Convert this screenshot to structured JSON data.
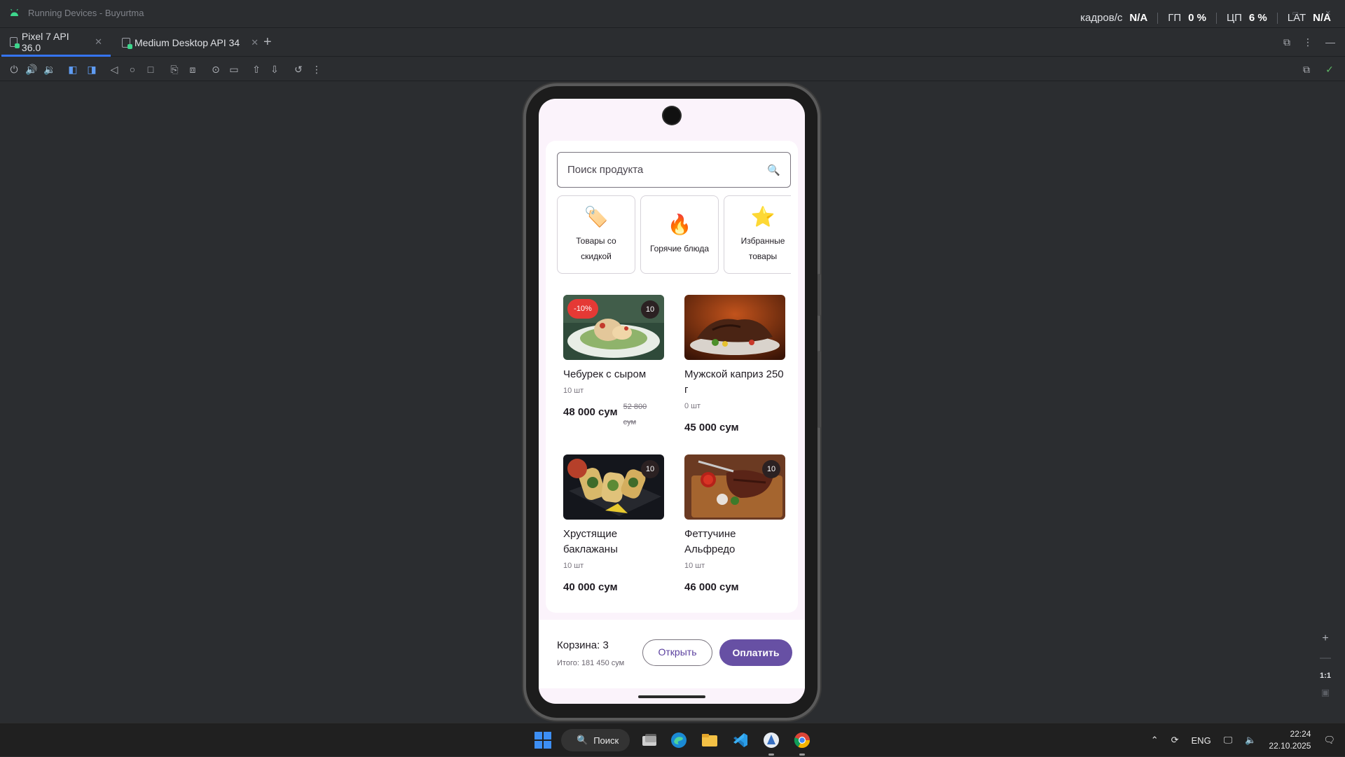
{
  "window": {
    "title": "Running Devices - Buyurtma"
  },
  "stats": [
    {
      "label": "кадров/с",
      "value": "N/A"
    },
    {
      "label": "ГП",
      "value": "0 %"
    },
    {
      "label": "ЦП",
      "value": "6 %"
    },
    {
      "label": "LAT",
      "value": "N/A"
    }
  ],
  "tabs": [
    {
      "label": "Pixel 7 API 36.0",
      "active": true
    },
    {
      "label": "Medium Desktop API 34",
      "active": false
    }
  ],
  "app": {
    "search": {
      "placeholder": "Поиск продукта"
    },
    "categories": [
      {
        "icon": "price-tag-icon",
        "emoji": "🏷️",
        "label": "Товары со скидкой"
      },
      {
        "icon": "fire-icon",
        "emoji": "🔥",
        "label": "Горячие блюда"
      },
      {
        "icon": "star-icon",
        "emoji": "⭐",
        "label": "Избранные товары"
      }
    ],
    "products": [
      {
        "name": "Чебурек с сыром",
        "qty": "10 шт",
        "price": "48 000 сум",
        "old_price": "52 800 сум",
        "badge": "10",
        "discount": "-10%"
      },
      {
        "name": "Мужской каприз 250 г",
        "qty": "0 шт",
        "price": "45 000 сум",
        "old_price": "",
        "badge": "",
        "discount": ""
      },
      {
        "name": "Хрустящие баклажаны",
        "qty": "10 шт",
        "price": "40 000 сум",
        "old_price": "",
        "badge": "10",
        "discount": ""
      },
      {
        "name": "Феттучине Альфредо",
        "qty": "10 шт",
        "price": "46 000 сум",
        "old_price": "",
        "badge": "10",
        "discount": ""
      }
    ],
    "cart": {
      "count_label": "Корзина: 3",
      "total_label": "Итого: 181 450 сум",
      "open_label": "Открыть",
      "pay_label": "Оплатить"
    }
  },
  "zoom": {
    "fit_label": "1:1"
  },
  "taskbar": {
    "search_label": "Поиск",
    "language": "ENG",
    "time": "22:24",
    "date": "22.10.2025"
  },
  "colors": {
    "accent": "#6750a4",
    "discount": "#e53935",
    "ide_bg": "#2b2d30",
    "active_tab": "#3574f0"
  }
}
